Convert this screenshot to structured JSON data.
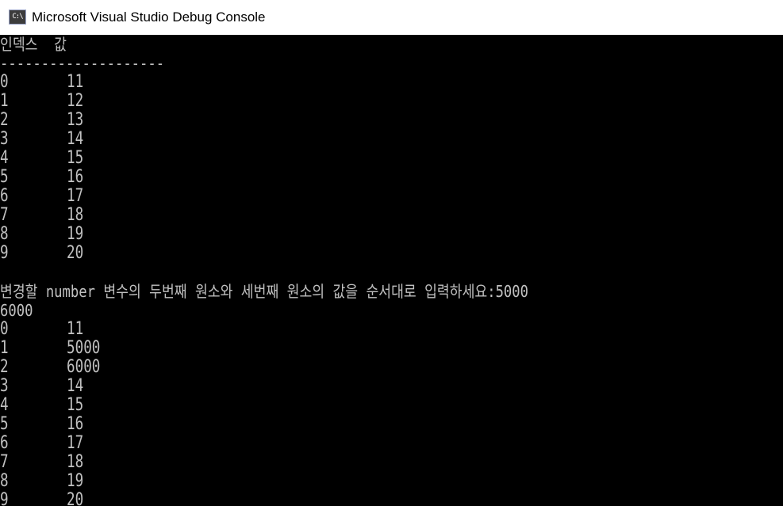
{
  "window": {
    "title": "Microsoft Visual Studio Debug Console",
    "icon_name": "console-app-icon",
    "icon_text": "C:\\"
  },
  "console": {
    "header": "인덱스  값",
    "separator": "--------------------",
    "table1": [
      {
        "index": "0",
        "value": "11"
      },
      {
        "index": "1",
        "value": "12"
      },
      {
        "index": "2",
        "value": "13"
      },
      {
        "index": "3",
        "value": "14"
      },
      {
        "index": "4",
        "value": "15"
      },
      {
        "index": "5",
        "value": "16"
      },
      {
        "index": "6",
        "value": "17"
      },
      {
        "index": "7",
        "value": "18"
      },
      {
        "index": "8",
        "value": "19"
      },
      {
        "index": "9",
        "value": "20"
      }
    ],
    "prompt": "변경할 number 변수의 두번째 원소와 세번째 원소의 값을 순서대로 입력하세요:5000",
    "input_second": "6000",
    "table2": [
      {
        "index": "0",
        "value": "11"
      },
      {
        "index": "1",
        "value": "5000"
      },
      {
        "index": "2",
        "value": "6000"
      },
      {
        "index": "3",
        "value": "14"
      },
      {
        "index": "4",
        "value": "15"
      },
      {
        "index": "5",
        "value": "16"
      },
      {
        "index": "6",
        "value": "17"
      },
      {
        "index": "7",
        "value": "18"
      },
      {
        "index": "8",
        "value": "19"
      },
      {
        "index": "9",
        "value": "20"
      }
    ]
  },
  "colors": {
    "console_bg": "#000000",
    "console_text": "#c0c0c0",
    "titlebar_bg": "#ffffff"
  }
}
